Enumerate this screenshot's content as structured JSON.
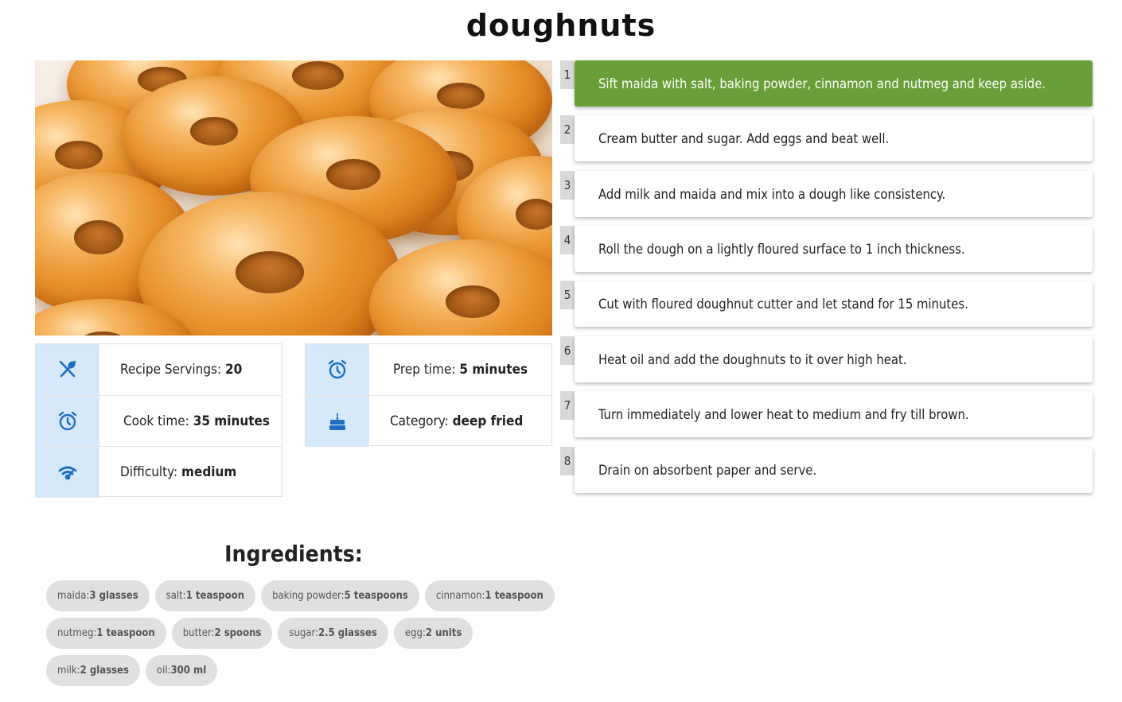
{
  "recipe": {
    "title": "doughnuts"
  },
  "info": {
    "servings_label": "Recipe Servings:",
    "servings_value": "20",
    "prep_label": "Prep time:",
    "prep_value": "5 minutes",
    "cook_label": "Cook time:",
    "cook_value": "35 minutes",
    "category_label": "Category:",
    "category_value": "deep fried",
    "difficulty_label": "Difficulty:",
    "difficulty_value": "medium"
  },
  "icons": {
    "servings": "utensils-icon",
    "prep": "alarm-clock-icon",
    "cook": "alarm-clock-icon",
    "category": "cake-icon",
    "difficulty": "signal-icon",
    "icon_color": "#1e6fc2",
    "icon_bg": "#d5e9fb"
  },
  "steps": [
    {
      "num": "1",
      "text": "Sift maida with salt, baking powder, cinnamon and nutmeg and keep aside.",
      "active": true
    },
    {
      "num": "2",
      "text": "Cream butter and sugar. Add eggs and beat well.",
      "active": false
    },
    {
      "num": "3",
      "text": "Add milk and maida and mix into a dough like consistency.",
      "active": false
    },
    {
      "num": "4",
      "text": "Roll the dough on a lightly floured surface to 1 inch thickness.",
      "active": false
    },
    {
      "num": "5",
      "text": "Cut with floured doughnut cutter and let stand for 15 minutes.",
      "active": false
    },
    {
      "num": "6",
      "text": "Heat oil and add the doughnuts to it over high heat.",
      "active": false
    },
    {
      "num": "7",
      "text": "Turn immediately and lower heat to medium and fry till brown.",
      "active": false
    },
    {
      "num": "8",
      "text": "Drain on absorbent paper and serve.",
      "active": false
    }
  ],
  "active_step_color": "#689f38",
  "ingredients": {
    "title": "Ingredients:",
    "items": [
      {
        "name": "maida:",
        "qty": "3 glasses"
      },
      {
        "name": "salt:",
        "qty": "1 teaspoon"
      },
      {
        "name": "baking powder:",
        "qty": "5 teaspoons"
      },
      {
        "name": "cinnamon:",
        "qty": "1 teaspoon"
      },
      {
        "name": "nutmeg:",
        "qty": "1 teaspoon"
      },
      {
        "name": "butter:",
        "qty": "2 spoons"
      },
      {
        "name": "sugar:",
        "qty": "2.5 glasses"
      },
      {
        "name": "egg:",
        "qty": "2 units"
      },
      {
        "name": "milk:",
        "qty": "2 glasses"
      },
      {
        "name": "oil:",
        "qty": "300 ml"
      }
    ]
  }
}
